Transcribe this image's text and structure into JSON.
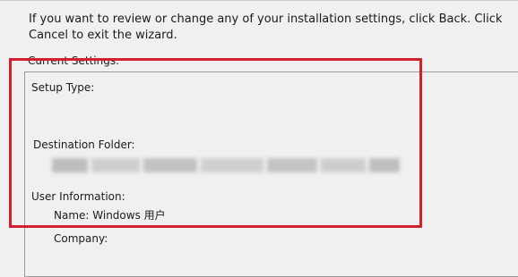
{
  "intro_text": "If you want to review or change any of your installation settings, click Back. Click Cancel to exit the wizard.",
  "current_settings": {
    "legend": "Current Settings:",
    "setup_type_label": "Setup Type:",
    "destination_folder_label": "Destination Folder:",
    "user_information_label": "User Information:",
    "name_line": "Name: Windows 用户",
    "company_line": "Company:"
  },
  "colors": {
    "highlight": "#d3202a",
    "background": "#f0f0f0"
  }
}
